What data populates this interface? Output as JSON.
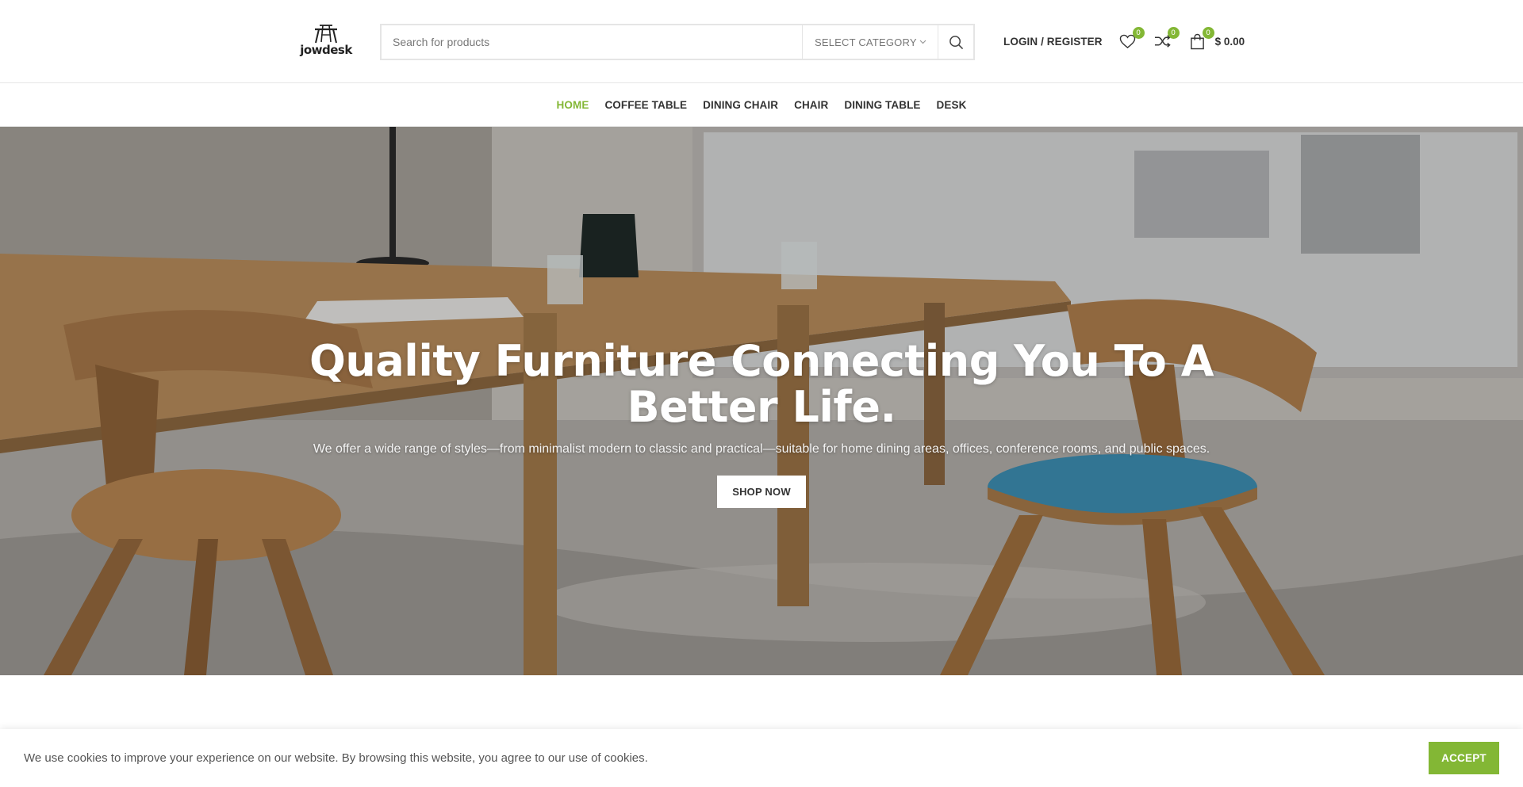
{
  "brand": {
    "name": "jowdesk"
  },
  "search": {
    "placeholder": "Search for products",
    "category_label": "SELECT CATEGORY"
  },
  "header_tools": {
    "login_label": "LOGIN / REGISTER",
    "wishlist_count": "0",
    "compare_count": "0",
    "cart_count": "0",
    "cart_total": "$ 0.00"
  },
  "nav": {
    "items": [
      {
        "label": "HOME",
        "active": true
      },
      {
        "label": "COFFEE TABLE",
        "active": false
      },
      {
        "label": "DINING CHAIR",
        "active": false
      },
      {
        "label": "CHAIR",
        "active": false
      },
      {
        "label": "DINING TABLE",
        "active": false
      },
      {
        "label": "DESK",
        "active": false
      }
    ]
  },
  "hero": {
    "title": "Quality Furniture Connecting You To A Better Life.",
    "subtitle": "We offer a wide range of styles—from minimalist modern to classic and practical—suitable for home dining areas, offices, conference rooms, and public spaces.",
    "cta_label": "SHOP NOW"
  },
  "cookie": {
    "text": "We use cookies to improve your experience on our website. By browsing this website, you agree to our use of cookies.",
    "accept_label": "ACCEPT"
  },
  "colors": {
    "accent": "#83b735",
    "text": "#333333",
    "border": "#e5e5e5"
  },
  "icons": [
    "logo-icon",
    "search-icon",
    "chevron-down-icon",
    "heart-icon",
    "shuffle-icon",
    "shopping-bag-icon"
  ]
}
